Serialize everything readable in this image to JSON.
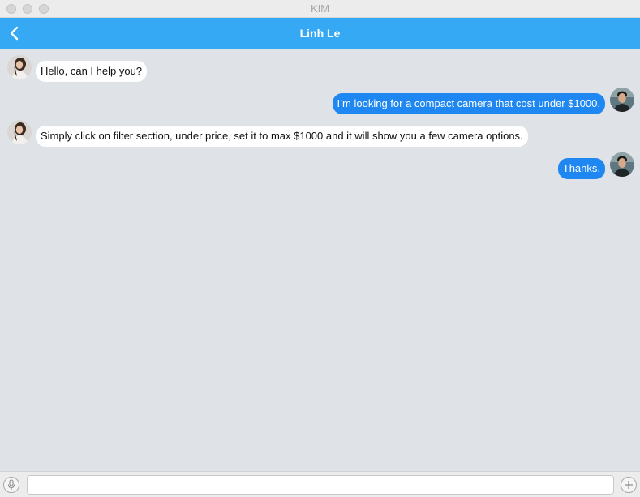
{
  "window": {
    "title": "KIM"
  },
  "header": {
    "contact_name": "Linh Le",
    "back_icon": "chevron-left-icon"
  },
  "colors": {
    "nav_bar": "#36a9f5",
    "outgoing_bubble": "#1f87f2",
    "incoming_bubble": "#ffffff",
    "chat_background": "#dfe2e7"
  },
  "messages": [
    {
      "sender": "contact",
      "text": "Hello, can I help you?"
    },
    {
      "sender": "me",
      "text": "I’m looking for a compact camera that cost under $1000."
    },
    {
      "sender": "contact",
      "text": "Simply click on filter section, under price, set it to max $1000 and it will show you a few camera options."
    },
    {
      "sender": "me",
      "text": "Thanks."
    }
  ],
  "composer": {
    "value": "",
    "placeholder": "",
    "mic_icon": "microphone-icon",
    "add_icon": "plus-icon"
  }
}
